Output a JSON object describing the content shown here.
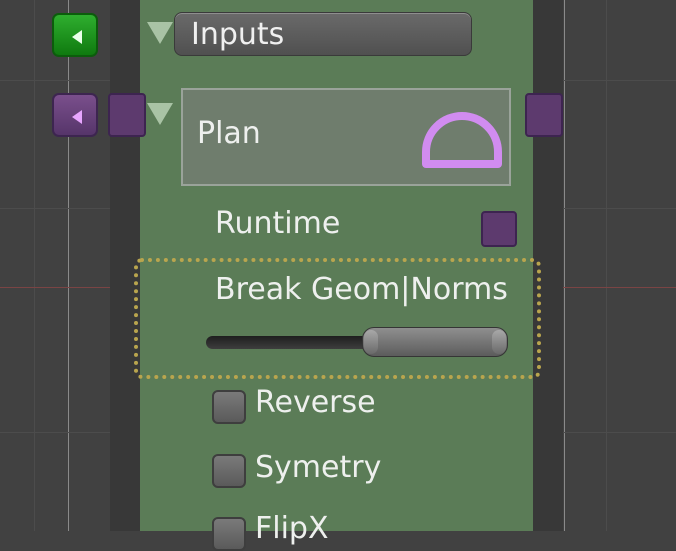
{
  "node": {
    "header_label": "Inputs",
    "plan": {
      "label": "Plan",
      "icon": "semicircle-icon"
    },
    "runtime_label": "Runtime",
    "break_geom_label": "Break Geom|Norms",
    "slider_value": 0.62,
    "checkboxes": [
      {
        "label": "Reverse"
      },
      {
        "label": "Symetry"
      },
      {
        "label": "FlipX"
      }
    ]
  },
  "colors": {
    "node_bg": "#5b7c57",
    "header_port": "#1d961d",
    "plan_port": "#6a4380",
    "plan_icon": "#d18cf0",
    "dotted_outline": "#b9a54e",
    "background": "#414141"
  }
}
